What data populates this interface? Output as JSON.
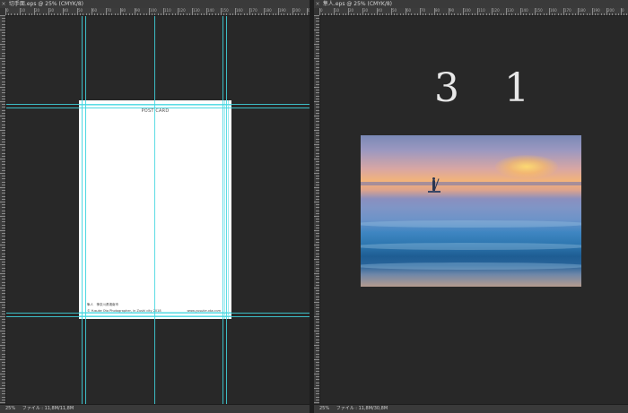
{
  "left": {
    "tab_close": "×",
    "tab_title": "切手面.eps @ 25% (CMYK/8)",
    "doc_title": "POST CARD",
    "address": "隼人　神奈川県湘南市",
    "copyright": "© Yusuke Ota Photographer, in Zushi city 2018",
    "url": "www.yusuke-ota.com",
    "status_zoom": "25%",
    "status_file": "ファイル : 11,8M/11,8M"
  },
  "right": {
    "tab_close": "×",
    "tab_title": "隼人.eps @ 25% (CMYK/8)",
    "page_numbers": "3 1",
    "status_zoom": "25%",
    "status_file": "ファイル : 11,8M/30,8M"
  },
  "ruler_labels": [
    "0",
    "10",
    "20",
    "30",
    "40",
    "50",
    "60",
    "70",
    "80",
    "90",
    "100",
    "110",
    "120",
    "130",
    "140",
    "150",
    "160",
    "170",
    "180",
    "190",
    "200"
  ],
  "guide_color": "#3fd6e0"
}
